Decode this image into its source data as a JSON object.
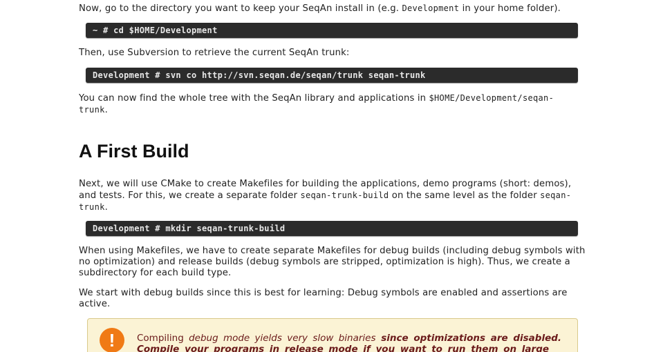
{
  "intro": {
    "p1_before": "Now, go to the directory you want to keep your SeqAn install in (e.g. ",
    "p1_code": "Development",
    "p1_after": " in your home folder).",
    "code1": "~ # cd $HOME/Development",
    "p2": "Then, use Subversion to retrieve the current SeqAn trunk:",
    "code2": "Development # svn co http://svn.seqan.de/seqan/trunk seqan-trunk",
    "p3_before": "You can now find the whole tree with the SeqAn library and applications in ",
    "p3_code1": "$HOME/Development/seqan-",
    "p3_code2": "trunk",
    "p3_after": "."
  },
  "section": {
    "heading": "A First Build",
    "p4_line1": "Next, we will use CMake to create Makefiles for building the applications, demo programs (short: demos),",
    "p4_line2_before": "and tests. For this, we create a separate folder ",
    "p4_code1": "seqan-trunk-build",
    "p4_line2_mid": " on the same level as the folder ",
    "p4_code2": "seqan-",
    "p4_code3": "trunk",
    "p4_after": ".",
    "code3": "Development # mkdir seqan-trunk-build",
    "p5_line1": "When using Makefiles, we have to create separate Makefiles for debug builds (including debug symbols with",
    "p5_line2": "no optimization) and release builds (debug symbols are stripped, optimization is high). Thus, we create a",
    "p5_line3": "subdirectory for each build type.",
    "p6_line1": "We start with debug builds since this is best for learning: Debug symbols are enabled and assertions are",
    "p6_line2": "active."
  },
  "warning": {
    "icon": "exclamation-icon",
    "icon_glyph": "!",
    "text_plain": "Compiling ",
    "text_em": "debug mode yields very slow binaries",
    "text_strong1": " since optimizations are disabled.",
    "text_strong2": "Compile your programs in release mode if you want to run them on large data sets.",
    "colors": {
      "background": "#fbf3d5",
      "border": "#d8c98a",
      "icon": "#f07a15",
      "text": "#6a1a1a"
    }
  }
}
